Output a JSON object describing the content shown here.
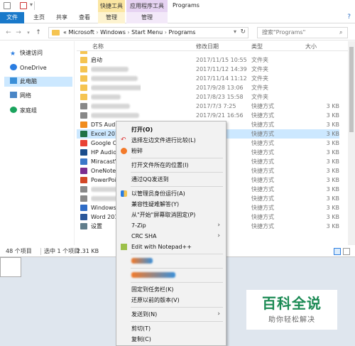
{
  "window": {
    "title": "Programs"
  },
  "ribbon": {
    "tabs": [
      "文件",
      "主页",
      "共享",
      "查看",
      "管理",
      "管理"
    ],
    "context_groups": [
      "快捷工具",
      "应用程序工具"
    ]
  },
  "address": {
    "prefix": "«",
    "crumbs": [
      "Microsoft",
      "Windows",
      "Start Menu",
      "Programs"
    ],
    "search_placeholder": "搜索\"Programs\""
  },
  "nav": {
    "items": [
      {
        "label": "快速访问",
        "icon": "star-icon"
      },
      {
        "label": "OneDrive",
        "icon": "cloud-icon"
      },
      {
        "label": "此电脑",
        "icon": "computer-icon"
      },
      {
        "label": "网络",
        "icon": "network-icon"
      },
      {
        "label": "家庭组",
        "icon": "homegroup-icon"
      }
    ]
  },
  "columns": [
    "名称",
    "修改日期",
    "类型",
    "大小"
  ],
  "files": [
    {
      "name": "启动",
      "date": "2017/11/15 10:55",
      "type": "文件夹",
      "size": ""
    },
    {
      "name": "",
      "date": "2017/11/12 14:39",
      "type": "文件夹",
      "size": ""
    },
    {
      "name": "",
      "date": "2017/11/14 11:12",
      "type": "文件夹",
      "size": ""
    },
    {
      "name": "",
      "date": "2017/9/28 13:06",
      "type": "文件夹",
      "size": ""
    },
    {
      "name": "",
      "date": "2017/8/23 15:58",
      "type": "文件夹",
      "size": ""
    },
    {
      "name": "",
      "date": "2017/7/3 7:25",
      "type": "快捷方式",
      "size": "3 KB"
    },
    {
      "name": "",
      "date": "2017/9/21 16:56",
      "type": "快捷方式",
      "size": "3 KB"
    },
    {
      "name": "DTS Audio",
      "date": "48",
      "type": "快捷方式",
      "size": "3 KB"
    },
    {
      "name": "Excel 2016",
      "date": "48",
      "type": "快捷方式",
      "size": "3 KB"
    },
    {
      "name": "Google Ch",
      "date": "12:47",
      "type": "快捷方式",
      "size": "3 KB"
    },
    {
      "name": "HP Audio",
      "date": "48",
      "type": "快捷方式",
      "size": "3 KB"
    },
    {
      "name": "MiracastV",
      "date": "57",
      "type": "快捷方式",
      "size": "3 KB"
    },
    {
      "name": "OneNote",
      "date": "48",
      "type": "快捷方式",
      "size": "3 KB"
    },
    {
      "name": "PowerPoi",
      "date": "48",
      "type": "快捷方式",
      "size": "3 KB"
    },
    {
      "name": "",
      "date": "57",
      "type": "快捷方式",
      "size": "3 KB"
    },
    {
      "name": "",
      "date": "16:28",
      "type": "快捷方式",
      "size": "3 KB"
    },
    {
      "name": "Windows",
      "date": "22:08",
      "type": "快捷方式",
      "size": "3 KB"
    },
    {
      "name": "Word 201",
      "date": "48",
      "type": "快捷方式",
      "size": "3 KB"
    },
    {
      "name": "设置",
      "date": "59",
      "type": "快捷方式",
      "size": "3 KB"
    }
  ],
  "status": {
    "count": "48 个项目",
    "selected": "选中 1 个项目",
    "size": "2.31 KB"
  },
  "context_menu": [
    {
      "label": "打开(O)",
      "bold": true
    },
    {
      "label": "选择左边文件进行比较(L)",
      "icon": "compare-icon"
    },
    {
      "label": "粉碎",
      "icon": "shred-icon"
    },
    {
      "sep": true
    },
    {
      "label": "打开文件所在的位置(I)"
    },
    {
      "sep": true
    },
    {
      "label": "通过QQ发送到"
    },
    {
      "sep": true
    },
    {
      "label": "以管理员身份运行(A)",
      "icon": "shield-icon"
    },
    {
      "label": "兼容性疑难解答(Y)"
    },
    {
      "label": "从\"开始\"屏幕取消固定(P)"
    },
    {
      "label": "7-Zip",
      "submenu": true
    },
    {
      "label": "CRC SHA",
      "submenu": true
    },
    {
      "label": "Edit with Notepad++",
      "icon": "notepad-icon"
    },
    {
      "sep": true
    },
    {
      "label": "",
      "redacted": true
    },
    {
      "sep": true
    },
    {
      "label": "",
      "redacted": true
    },
    {
      "sep": true
    },
    {
      "label": "固定到任务栏(K)"
    },
    {
      "label": "还原以前的版本(V)"
    },
    {
      "sep": true
    },
    {
      "label": "发送到(N)",
      "submenu": true
    },
    {
      "sep": true
    },
    {
      "label": "剪切(T)"
    },
    {
      "label": "复制(C)"
    }
  ],
  "watermark": {
    "title": "百科全说",
    "subtitle": "助你轻松解决"
  },
  "colors": {
    "accent": "#1979ca",
    "selection": "#cce8ff",
    "folder": "#f5c451",
    "brand": "#1b8a54"
  }
}
